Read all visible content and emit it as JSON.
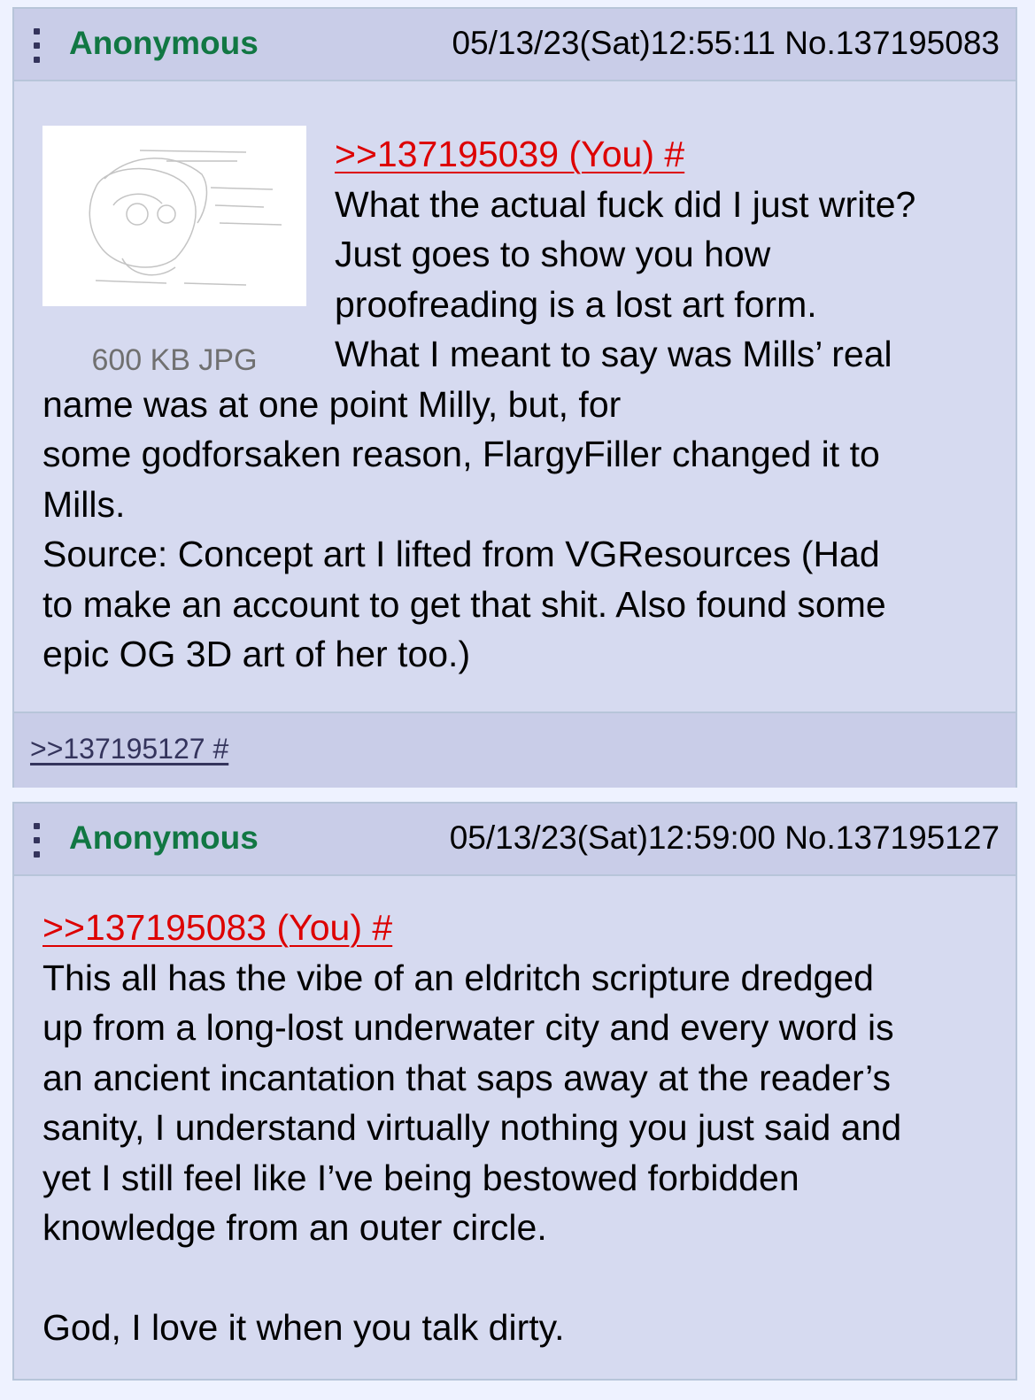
{
  "posts": [
    {
      "name": "Anonymous",
      "meta": "05/13/23(Sat)12:55:11 No.137195083",
      "file_info": "600 KB JPG",
      "quote": ">>137195039 (You) #",
      "lines": [
        "What the actual fuck did I just write?",
        "Just goes to show you how",
        "proofreading is a lost art form.",
        "What I meant to say was Mills’ real",
        "name was at one point Milly, but, for",
        "some godforsaken reason, FlargyFiller changed it to",
        "Mills.",
        "Source: Concept art I lifted from VGResources (Had",
        "to make an account to get that shit. Also found some",
        "epic OG 3D art of her too.)"
      ],
      "backlink": ">>137195127 #"
    },
    {
      "name": "Anonymous",
      "meta": "05/13/23(Sat)12:59:00 No.137195127",
      "quote": ">>137195083 (You) #",
      "lines": [
        "This all has the vibe of an eldritch scripture dredged",
        "up from a long-lost underwater city and every word is",
        "an ancient incantation that saps away at the reader’s",
        "sanity, I understand virtually nothing you just said and",
        "yet I still feel like I’ve being bestowed forbidden",
        "knowledge from an outer circle.",
        "",
        "God, I love it when you talk dirty."
      ]
    }
  ],
  "colors": {
    "name": "#117743",
    "quote": "#dd0000",
    "post_bg": "#d6daf0",
    "header_bg": "#c9cde8",
    "border": "#b7c5d9"
  },
  "icons": [
    "kebab-menu-icon",
    "image-thumbnail"
  ]
}
